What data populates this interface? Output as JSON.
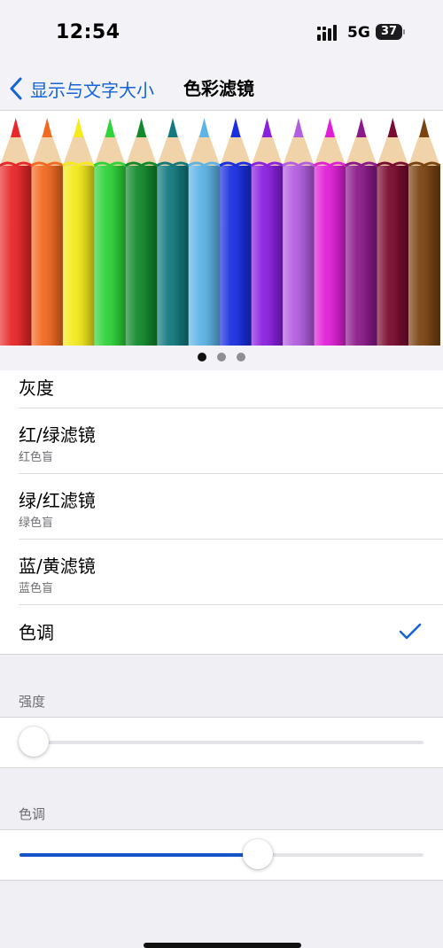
{
  "status_bar": {
    "time": "12:54",
    "network": "5G",
    "battery": "37"
  },
  "nav": {
    "back_label": "显示与文字大小",
    "title": "色彩滤镜"
  },
  "preview": {
    "page_count": 3,
    "active_page": 0,
    "pencil_colors": [
      "#e8282a",
      "#f26a22",
      "#f4ea1c",
      "#2fd33a",
      "#128a2c",
      "#127a7e",
      "#5eb4e6",
      "#1a2fe0",
      "#8a20e0",
      "#b35ee0",
      "#e020d8",
      "#8a1a8a",
      "#7a0c30",
      "#7a4412"
    ]
  },
  "filters": [
    {
      "title": "灰度",
      "subtitle": "",
      "selected": false
    },
    {
      "title": "红/绿滤镜",
      "subtitle": "红色盲",
      "selected": false
    },
    {
      "title": "绿/红滤镜",
      "subtitle": "绿色盲",
      "selected": false
    },
    {
      "title": "蓝/黄滤镜",
      "subtitle": "蓝色盲",
      "selected": false
    },
    {
      "title": "色调",
      "subtitle": "",
      "selected": true
    }
  ],
  "intensity": {
    "label": "强度",
    "value": 0.0
  },
  "hue": {
    "label": "色调",
    "value": 0.59
  },
  "colors": {
    "accent": "#1563d9",
    "slider_fill": "#1554c9"
  }
}
